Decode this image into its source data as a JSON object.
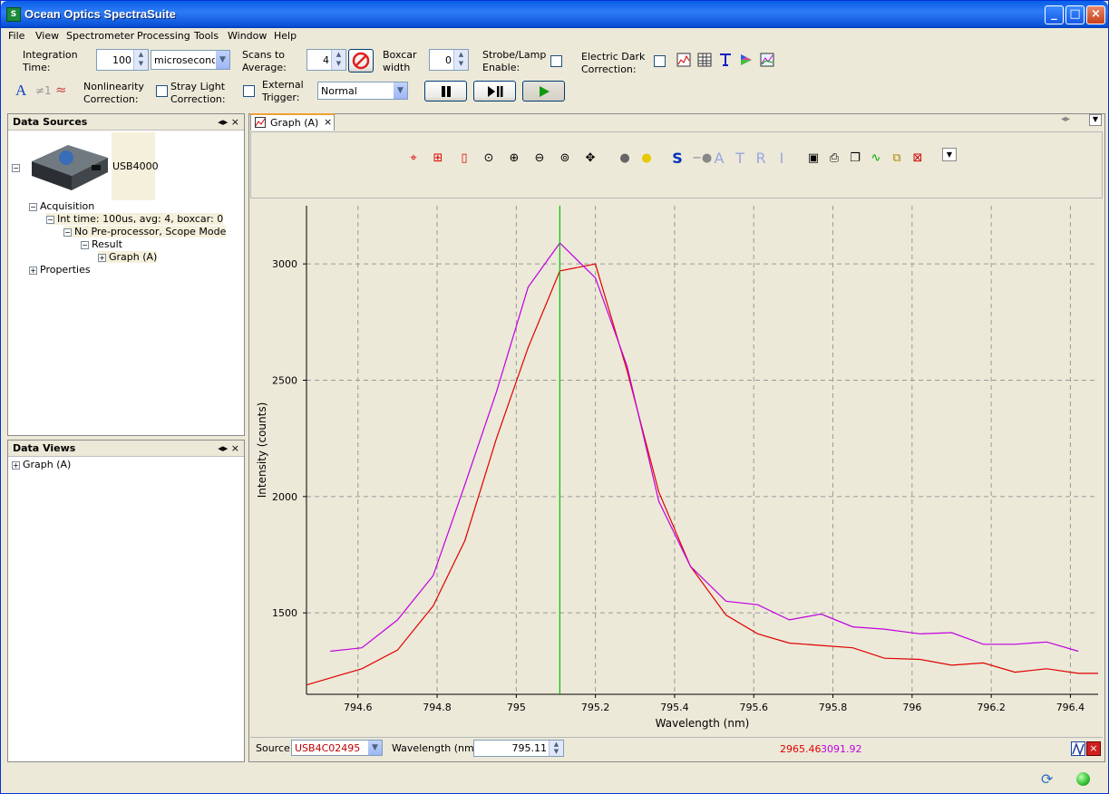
{
  "window": {
    "title": "Ocean Optics SpectraSuite"
  },
  "menu": [
    "File",
    "View",
    "Spectrometer",
    "Processing",
    "Tools",
    "Window",
    "Help"
  ],
  "toolbar": {
    "integration_time_label_1": "Integration",
    "integration_time_label_2": "Time:",
    "integration_time_value": "100",
    "integration_units": "microseconds",
    "scans_label_1": "Scans to",
    "scans_label_2": "Average:",
    "scans_value": "4",
    "boxcar_label_1": "Boxcar",
    "boxcar_label_2": "width",
    "boxcar_value": "0",
    "strobe_label_1": "Strobe/Lamp",
    "strobe_label_2": "Enable:",
    "dark_label_1": "Electric Dark",
    "dark_label_2": "Correction:",
    "nonlin_label_1": "Nonlinearity",
    "nonlin_label_2": "Correction:",
    "stray_label_1": "Stray Light",
    "stray_label_2": "Correction:",
    "trigger_label_1": "External",
    "trigger_label_2": "Trigger:",
    "trigger_mode": "Normal",
    "a_glyph": "A",
    "ne1_glyph": "≠1"
  },
  "data_sources": {
    "title": "Data Sources",
    "device": "USB4000",
    "acquisition": "Acquisition",
    "int_time": "Int time: 100us, avg: 4, boxcar: 0",
    "preproc": "No Pre-processor, Scope Mode",
    "result": "Result",
    "graph": "Graph (A)",
    "properties": "Properties"
  },
  "data_views": {
    "title": "Data Views",
    "graph": "Graph (A)"
  },
  "graph_tab": {
    "label": "Graph (A)"
  },
  "graph_toolbar_letters": [
    "S",
    "A",
    "T",
    "R",
    "I"
  ],
  "status": {
    "source_label": "Source:",
    "source_value": "USB4C02495",
    "wavelength_label": "Wavelength (nm):",
    "wavelength_value": "795.11",
    "reading_1": "2965.46",
    "reading_2": "3091.92"
  },
  "colors": {
    "series_red": "#E00000",
    "series_magenta": "#C000E0",
    "cursor": "#00C000"
  },
  "chart_data": {
    "type": "line",
    "xlabel": "Wavelength (nm)",
    "ylabel": "Intensity (counts)",
    "xlim": [
      794.47,
      796.47
    ],
    "ylim": [
      1150,
      3250
    ],
    "xticks": [
      "794.6",
      "794.8",
      "795",
      "795.2",
      "795.4",
      "795.6",
      "795.8",
      "796",
      "796.2",
      "796.4"
    ],
    "yticks": [
      "1500",
      "2000",
      "2500",
      "3000"
    ],
    "grid": true,
    "cursor_x": 795.11,
    "series": [
      {
        "color": "#E00000",
        "x": [
          794.47,
          794.61,
          794.7,
          794.79,
          794.87,
          794.95,
          795.03,
          795.11,
          795.2,
          795.28,
          795.36,
          795.44,
          795.53,
          795.61,
          795.69,
          795.77,
          795.85,
          795.93,
          796.02,
          796.1,
          796.18,
          796.26,
          796.34,
          796.42,
          796.47
        ],
        "y": [
          1190,
          1260,
          1340,
          1530,
          1810,
          2250,
          2640,
          2970,
          3000,
          2540,
          2020,
          1700,
          1490,
          1410,
          1370,
          1360,
          1350,
          1305,
          1300,
          1275,
          1285,
          1245,
          1260,
          1240,
          1240
        ]
      },
      {
        "color": "#C000E0",
        "x": [
          794.53,
          794.61,
          794.7,
          794.79,
          794.87,
          794.95,
          795.03,
          795.11,
          795.2,
          795.28,
          795.36,
          795.44,
          795.53,
          795.61,
          795.69,
          795.77,
          795.85,
          795.93,
          796.02,
          796.1,
          796.18,
          796.26,
          796.34,
          796.42
        ],
        "y": [
          1335,
          1350,
          1470,
          1660,
          2050,
          2450,
          2900,
          3090,
          2940,
          2560,
          1980,
          1700,
          1550,
          1535,
          1470,
          1495,
          1440,
          1430,
          1410,
          1415,
          1365,
          1365,
          1375,
          1335
        ]
      }
    ]
  }
}
